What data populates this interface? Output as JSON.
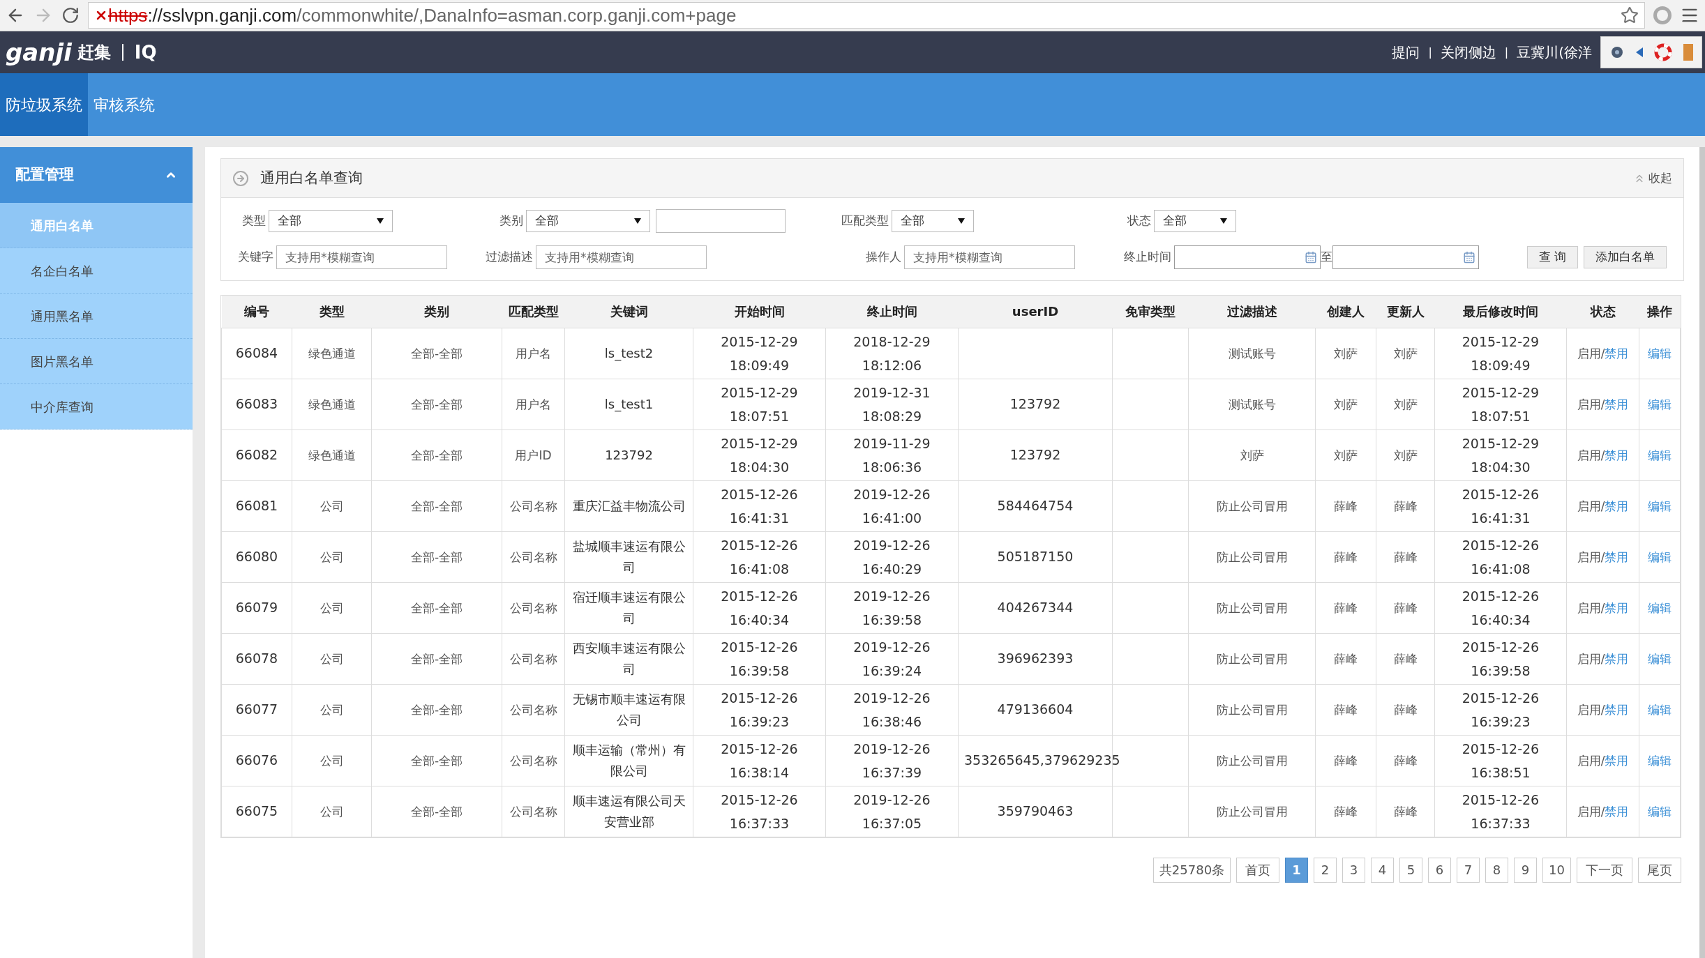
{
  "browser": {
    "url_scheme": "https",
    "url_host": "://sslvpn.ganji.com",
    "url_path": "/commonwhite/,DanaInfo=asman.corp.ganji.com+page"
  },
  "header": {
    "logo_text": "ganji",
    "logo_cn": "赶集",
    "logo_suffix": "IQ",
    "links": [
      "提问",
      "关闭侧边",
      "豆冀川(徐洋"
    ],
    "separator": "|"
  },
  "nav": {
    "tabs": [
      {
        "label": "防垃圾系统",
        "selected": true
      },
      {
        "label": "审核系统",
        "selected": false
      }
    ]
  },
  "sidebar": {
    "group": {
      "label": "配置管理",
      "expanded": true
    },
    "items": [
      {
        "label": "通用白名单",
        "selected": true
      },
      {
        "label": "名企白名单",
        "selected": false
      },
      {
        "label": "通用黑名单",
        "selected": false
      },
      {
        "label": "图片黑名单",
        "selected": false
      },
      {
        "label": "中介库查询",
        "selected": false
      }
    ]
  },
  "panel": {
    "title": "通用白名单查询",
    "collapse": "收起"
  },
  "filters": {
    "type": {
      "label": "类型",
      "value": "全部"
    },
    "category": {
      "label": "类别",
      "value": "全部"
    },
    "match_type": {
      "label": "匹配类型",
      "value": "全部"
    },
    "status": {
      "label": "状态",
      "value": "全部"
    },
    "keyword": {
      "label": "关键字",
      "placeholder": "支持用*模糊查询"
    },
    "filter_desc": {
      "label": "过滤描述",
      "placeholder": "支持用*模糊查询"
    },
    "operator": {
      "label": "操作人",
      "placeholder": "支持用*模糊查询"
    },
    "end_time": {
      "label": "终止时间",
      "to": "至"
    },
    "buttons": [
      "查 询",
      "添加白名单"
    ]
  },
  "table": {
    "columns": [
      "编号",
      "类型",
      "类别",
      "匹配类型",
      "关键词",
      "开始时间",
      "终止时间",
      "userID",
      "免审类型",
      "过滤描述",
      "创建人",
      "更新人",
      "最后修改时间",
      "状态",
      "操作"
    ],
    "rows": [
      {
        "id": "66084",
        "type": "绿色通道",
        "category": "全部-全部",
        "match_type": "用户名",
        "keyword": "ls_test2",
        "start": "2015-12-29 18:09:49",
        "end": "2018-12-29 18:12:06",
        "user_id": "",
        "desc": "测试账号",
        "creator": "刘萨",
        "updater": "刘萨",
        "modified": "2015-12-29 18:09:49",
        "status_text": "启用/",
        "status_action": "禁用",
        "action": "编辑"
      },
      {
        "id": "66083",
        "type": "绿色通道",
        "category": "全部-全部",
        "match_type": "用户名",
        "keyword": "ls_test1",
        "start": "2015-12-29 18:07:51",
        "end": "2019-12-31 18:08:29",
        "user_id": "123792",
        "desc": "测试账号",
        "creator": "刘萨",
        "updater": "刘萨",
        "modified": "2015-12-29 18:07:51",
        "status_text": "启用/",
        "status_action": "禁用",
        "action": "编辑"
      },
      {
        "id": "66082",
        "type": "绿色通道",
        "category": "全部-全部",
        "match_type": "用户ID",
        "keyword": "123792",
        "start": "2015-12-29 18:04:30",
        "end": "2019-11-29 18:06:36",
        "user_id": "123792",
        "desc": "刘萨",
        "creator": "刘萨",
        "updater": "刘萨",
        "modified": "2015-12-29 18:04:30",
        "status_text": "启用/",
        "status_action": "禁用",
        "action": "编辑"
      },
      {
        "id": "66081",
        "type": "公司",
        "category": "全部-全部",
        "match_type": "公司名称",
        "keyword": "重庆汇益丰物流公司",
        "start": "2015-12-26 16:41:31",
        "end": "2019-12-26 16:41:00",
        "user_id": "584464754",
        "desc": "防止公司冒用",
        "creator": "薛峰",
        "updater": "薛峰",
        "modified": "2015-12-26 16:41:31",
        "status_text": "启用/",
        "status_action": "禁用",
        "action": "编辑"
      },
      {
        "id": "66080",
        "type": "公司",
        "category": "全部-全部",
        "match_type": "公司名称",
        "keyword": "盐城顺丰速运有限公司",
        "start": "2015-12-26 16:41:08",
        "end": "2019-12-26 16:40:29",
        "user_id": "505187150",
        "desc": "防止公司冒用",
        "creator": "薛峰",
        "updater": "薛峰",
        "modified": "2015-12-26 16:41:08",
        "status_text": "启用/",
        "status_action": "禁用",
        "action": "编辑"
      },
      {
        "id": "66079",
        "type": "公司",
        "category": "全部-全部",
        "match_type": "公司名称",
        "keyword": "宿迁顺丰速运有限公司",
        "start": "2015-12-26 16:40:34",
        "end": "2019-12-26 16:39:58",
        "user_id": "404267344",
        "desc": "防止公司冒用",
        "creator": "薛峰",
        "updater": "薛峰",
        "modified": "2015-12-26 16:40:34",
        "status_text": "启用/",
        "status_action": "禁用",
        "action": "编辑"
      },
      {
        "id": "66078",
        "type": "公司",
        "category": "全部-全部",
        "match_type": "公司名称",
        "keyword": "西安顺丰速运有限公司",
        "start": "2015-12-26 16:39:58",
        "end": "2019-12-26 16:39:24",
        "user_id": "396962393",
        "desc": "防止公司冒用",
        "creator": "薛峰",
        "updater": "薛峰",
        "modified": "2015-12-26 16:39:58",
        "status_text": "启用/",
        "status_action": "禁用",
        "action": "编辑"
      },
      {
        "id": "66077",
        "type": "公司",
        "category": "全部-全部",
        "match_type": "公司名称",
        "keyword": "无锡市顺丰速运有限公司",
        "start": "2015-12-26 16:39:23",
        "end": "2019-12-26 16:38:46",
        "user_id": "479136604",
        "desc": "防止公司冒用",
        "creator": "薛峰",
        "updater": "薛峰",
        "modified": "2015-12-26 16:39:23",
        "status_text": "启用/",
        "status_action": "禁用",
        "action": "编辑"
      },
      {
        "id": "66076",
        "type": "公司",
        "category": "全部-全部",
        "match_type": "公司名称",
        "keyword": "顺丰运输（常州）有限公司",
        "start": "2015-12-26 16:38:14",
        "end": "2019-12-26 16:37:39",
        "user_id": "353265645,379629235",
        "desc": "防止公司冒用",
        "creator": "薛峰",
        "updater": "薛峰",
        "modified": "2015-12-26 16:38:51",
        "status_text": "启用/",
        "status_action": "禁用",
        "action": "编辑"
      },
      {
        "id": "66075",
        "type": "公司",
        "category": "全部-全部",
        "match_type": "公司名称",
        "keyword": "顺丰速运有限公司天安营业部",
        "start": "2015-12-26 16:37:33",
        "end": "2019-12-26 16:37:05",
        "user_id": "359790463",
        "desc": "防止公司冒用",
        "creator": "薛峰",
        "updater": "薛峰",
        "modified": "2015-12-26 16:37:33",
        "status_text": "启用/",
        "status_action": "禁用",
        "action": "编辑"
      }
    ]
  },
  "pagination": {
    "total": "共25780条",
    "first": "首页",
    "pages": [
      {
        "label": "1",
        "selected": true
      },
      {
        "label": "2",
        "selected": false
      },
      {
        "label": "3",
        "selected": false
      },
      {
        "label": "4",
        "selected": false
      },
      {
        "label": "5",
        "selected": false
      },
      {
        "label": "6",
        "selected": false
      },
      {
        "label": "7",
        "selected": false
      },
      {
        "label": "8",
        "selected": false
      },
      {
        "label": "9",
        "selected": false
      },
      {
        "label": "10",
        "selected": false
      }
    ],
    "next": "下一页",
    "last": "尾页"
  }
}
